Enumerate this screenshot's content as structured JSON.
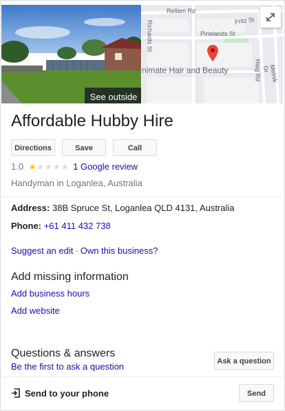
{
  "header": {
    "see_outside_label": "See outside",
    "map_streets": [
      "Rellam Rd",
      "Fritz St",
      "Richards St",
      "Pinelands St",
      "Haig Rd",
      "Melnik Dr"
    ],
    "map_place_label": "nimate Hair and Beauty"
  },
  "business": {
    "name": "Affordable Hubby Hire",
    "category": "Handyman in Loganlea, Australia"
  },
  "actions": {
    "directions": "Directions",
    "save": "Save",
    "call": "Call"
  },
  "rating": {
    "value": "1.0",
    "stars_filled": 1,
    "stars_total": 5,
    "reviews_link": "1 Google review"
  },
  "details": {
    "address_label": "Address:",
    "address_value": "38B Spruce St, Loganlea QLD 4131, Australia",
    "phone_label": "Phone:",
    "phone_value": "+61 411 432 738"
  },
  "links": {
    "suggest_edit": "Suggest an edit",
    "separator": "·",
    "own_business": "Own this business?"
  },
  "missing_info": {
    "title": "Add missing information",
    "add_hours": "Add business hours",
    "add_website": "Add website"
  },
  "qa": {
    "title": "Questions & answers",
    "first_link": "Be the first to ask a question",
    "ask_button": "Ask a question"
  },
  "send": {
    "label": "Send to your phone",
    "button": "Send"
  },
  "colors": {
    "link": "#1a0dab",
    "star": "#fbbc04",
    "map_pin": "#ea4335"
  }
}
